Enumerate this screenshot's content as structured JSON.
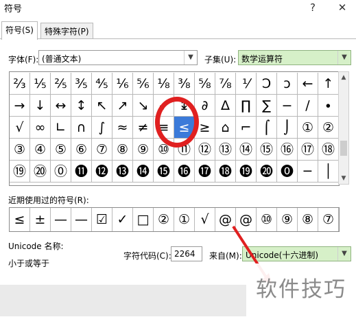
{
  "window": {
    "title": "符号",
    "help_glyph": "?",
    "close_glyph": "✕"
  },
  "tabs": [
    {
      "label": "符号(S)"
    },
    {
      "label": "特殊字符(P)"
    }
  ],
  "font": {
    "label": "字体(F):",
    "value": "(普通文本)"
  },
  "subset": {
    "label": "子集(U):",
    "value": "数学运算符"
  },
  "symbol_grid": {
    "rows": [
      [
        "⅔",
        "⅕",
        "⅖",
        "⅗",
        "⅘",
        "⅙",
        "⅚",
        "⅛",
        "⅜",
        "⅝",
        "⅞",
        "⅟",
        "Ↄ",
        "ↄ",
        "←",
        "↑"
      ],
      [
        "→",
        "↓",
        "↔",
        "↕",
        "↖",
        "↗",
        "↘",
        "↙",
        "↨",
        "∂",
        "∆",
        "∏",
        "∑",
        "−",
        "∕",
        "∙"
      ],
      [
        "√",
        "∞",
        "∟",
        "∩",
        "∫",
        "≈",
        "≠",
        "≡",
        "≤",
        "≥",
        "⌂",
        "⌐",
        "⌠",
        "⌡",
        "①",
        "②"
      ],
      [
        "③",
        "④",
        "⑤",
        "⑥",
        "⑦",
        "⑧",
        "⑨",
        "⑩",
        "⑪",
        "⑫",
        "⑬",
        "⑭",
        "⑮",
        "⑯",
        "⑰",
        "⑱"
      ],
      [
        "⑲",
        "⑳",
        "⓪",
        "⓫",
        "⓬",
        "⓭",
        "⓮",
        "⓯",
        "⓰",
        "⓱",
        "⓲",
        "⓳",
        "⓴",
        "⓿",
        "─",
        "│"
      ]
    ],
    "selected_symbol": "≤"
  },
  "recent": {
    "label": "近期使用过的符号(R):",
    "symbols": [
      "≤",
      "±",
      "—",
      "—",
      "☑",
      "✓",
      "□",
      "②",
      "①",
      "√",
      "@",
      "@",
      "⑩",
      "⑨",
      "⑧",
      "⑦"
    ]
  },
  "unicode_name": {
    "label": "Unicode 名称:",
    "value": "小于或等于"
  },
  "char_code": {
    "label": "字符代码(C):",
    "value": "2264"
  },
  "from": {
    "label": "来自(M):",
    "value": "Unicode(十六进制)"
  },
  "watermark": "软件技巧",
  "colors": {
    "highlight": "#e02020",
    "selection": "#3b7ad9",
    "subset_bg": "#d6f0c8"
  }
}
